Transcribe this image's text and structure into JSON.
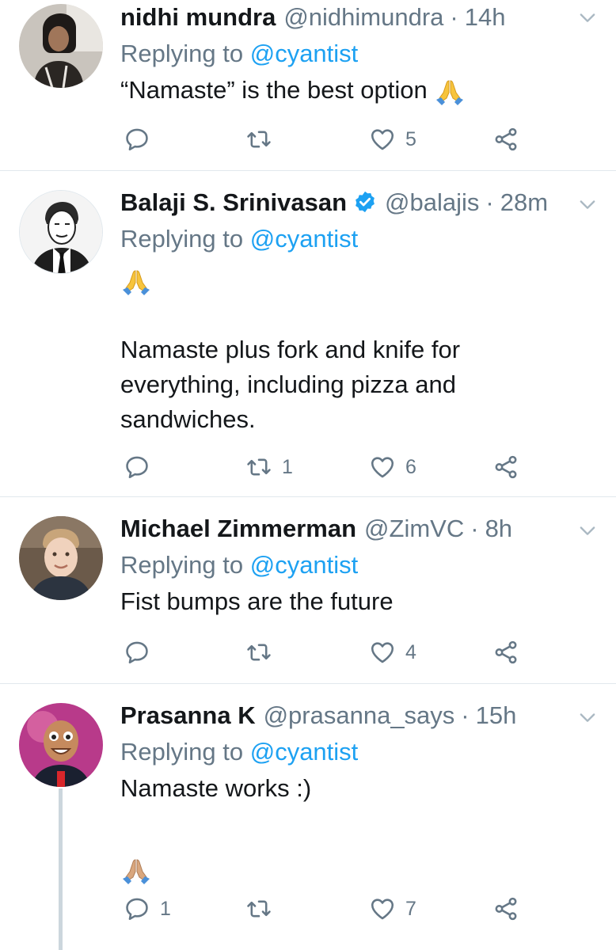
{
  "colors": {
    "link": "#1da1f2",
    "muted": "#657786",
    "text": "#14171a",
    "divider": "#e1e8ed",
    "verified": "#1da1f2"
  },
  "tweets": [
    {
      "name": "nidhi mundra",
      "handle": "@nidhimundra",
      "time": "14h",
      "replying_prefix": "Replying to",
      "replying_to": "@cyantist",
      "text_lines": [
        "“Namaste” is the best option"
      ],
      "reply_count": "",
      "retweet_count": "",
      "like_count": "5"
    },
    {
      "name": "Balaji S. Srinivasan",
      "verified": true,
      "handle": "@balajis",
      "time": "28m",
      "replying_prefix": "Replying to",
      "replying_to": "@cyantist",
      "text_lines": [
        "Namaste plus fork and knife for",
        "everything, including pizza and",
        "sandwiches."
      ],
      "reply_count": "",
      "retweet_count": "1",
      "like_count": "6"
    },
    {
      "name": "Michael Zimmerman",
      "handle": "@ZimVC",
      "time": "8h",
      "replying_prefix": "Replying to",
      "replying_to": "@cyantist",
      "text_lines": [
        "Fist bumps are the future"
      ],
      "reply_count": "",
      "retweet_count": "",
      "like_count": "4"
    },
    {
      "name": "Prasanna K",
      "handle": "@prasanna_says",
      "time": "15h",
      "replying_prefix": "Replying to",
      "replying_to": "@cyantist",
      "text_lines": [
        "Namaste works :)"
      ],
      "reply_count": "1",
      "retweet_count": "",
      "like_count": "7"
    }
  ],
  "separator": "·"
}
